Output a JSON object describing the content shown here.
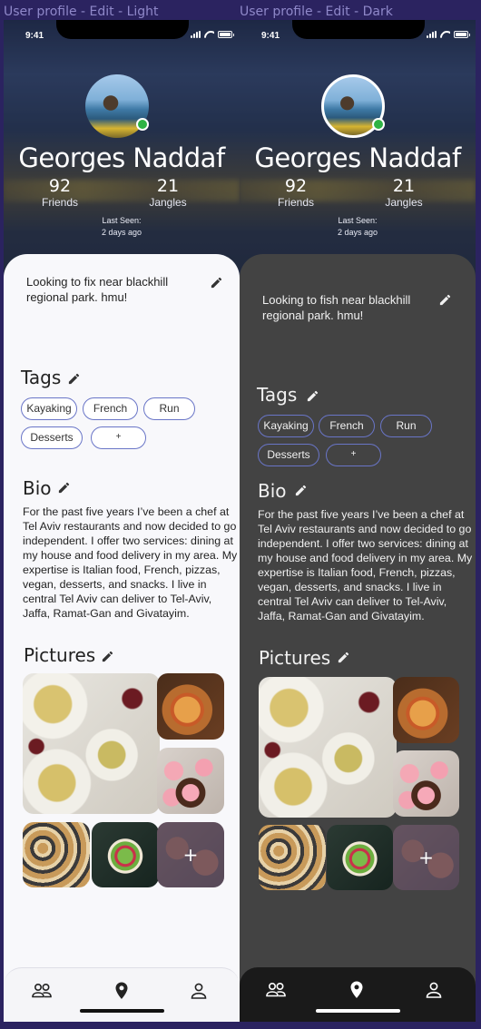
{
  "frames": [
    {
      "label": "User profile - Edit - Light",
      "status_time": "9:41",
      "profile": {
        "name": "Georges Naddaf",
        "friends_count": "92",
        "friends_label": "Friends",
        "jangles_count": "21",
        "jangles_label": "Jangles",
        "last_seen_label": "Last Seen:",
        "last_seen_value": "2 days ago"
      },
      "status_message": "Looking to fix near blackhill regional park. hmu!",
      "tags_title": "Tags",
      "tags": [
        "Kayaking",
        "French",
        "Run",
        "Desserts",
        "+"
      ],
      "bio_title": "Bio",
      "bio_text": "For the past five years I’ve been a chef at Tel Aviv restaurants and now decided to go independent. I offer two services: dining at my house and food delivery in my area. My expertise is Italian food, French, pizzas, vegan, desserts, and snacks. I live in central Tel Aviv can deliver to Tel-Aviv, Jaffa, Ramat-Gan and Givatayim.",
      "pictures_title": "Pictures",
      "pictures_more": "+"
    },
    {
      "label": "User profile - Edit - Dark",
      "status_time": "9:41",
      "profile": {
        "name": "Georges Naddaf",
        "friends_count": "92",
        "friends_label": "Friends",
        "jangles_count": "21",
        "jangles_label": "Jangles",
        "last_seen_label": "Last Seen:",
        "last_seen_value": "2 days ago"
      },
      "status_message": "Looking to fish near blackhill regional park. hmu!",
      "tags_title": "Tags",
      "tags": [
        "Kayaking",
        "French",
        "Run",
        "Desserts",
        "+"
      ],
      "bio_title": "Bio",
      "bio_text": "For the past five years I’ve been a chef at Tel Aviv restaurants and now decided to go independent. I offer two services: dining at my house and food delivery in my area. My expertise is Italian food, French, pizzas, vegan, desserts, and snacks. I live in central Tel Aviv can deliver to Tel-Aviv, Jaffa, Ramat-Gan and Givatayim.",
      "pictures_title": "Pictures",
      "pictures_more": "+"
    }
  ],
  "icons": {
    "edit": "pencil-icon",
    "nav_friends": "people-icon",
    "nav_map": "location-pin-icon",
    "nav_profile": "person-icon"
  },
  "colors": {
    "canvas_background": "#2b2360",
    "light_sheet": "#f8f8fb",
    "dark_sheet": "#434343",
    "tag_outline": "#6975c7",
    "online_indicator": "#2fb344"
  }
}
